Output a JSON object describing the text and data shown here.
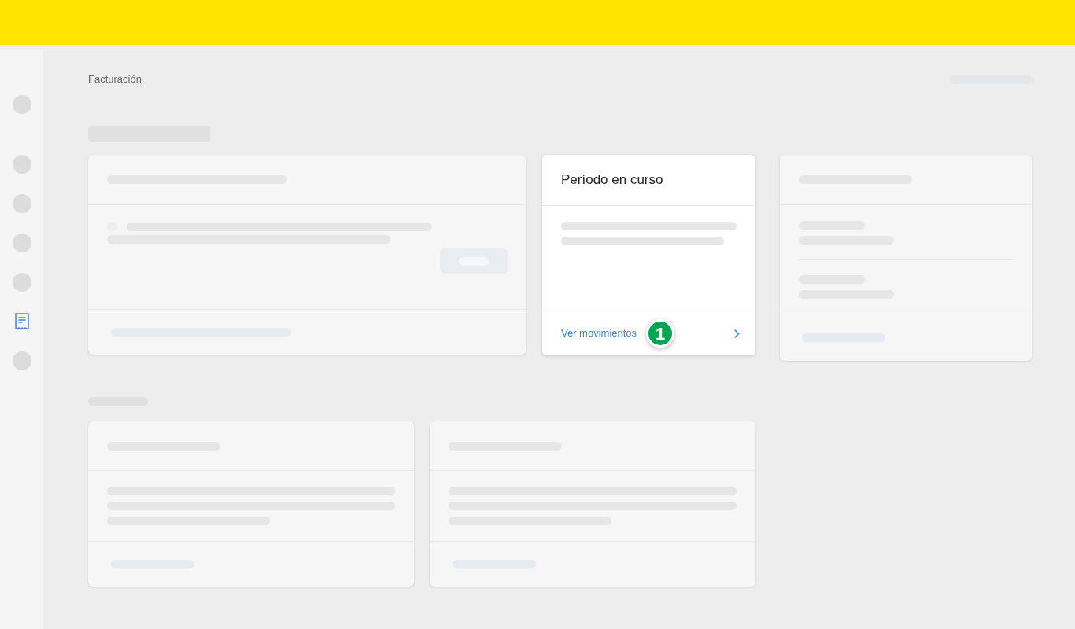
{
  "sidebar": {
    "items": [
      {
        "selected": false
      },
      {
        "selected": false
      },
      {
        "selected": false
      },
      {
        "selected": false
      },
      {
        "selected": false
      },
      {
        "selected": true
      },
      {
        "selected": false
      }
    ]
  },
  "breadcrumb": "Facturación",
  "period_card": {
    "title": "Período en curso",
    "link": "Ver movimientos",
    "step_badge": "1"
  }
}
